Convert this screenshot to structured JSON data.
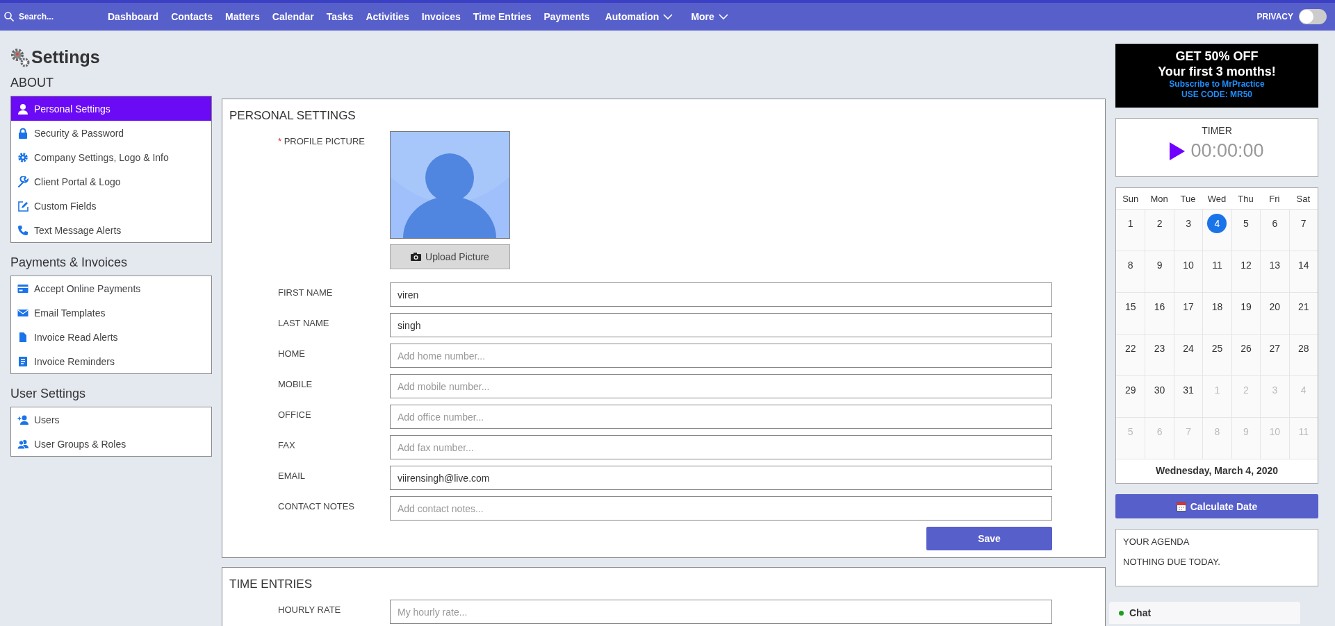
{
  "top_nav": {
    "search": {
      "placeholder": "Search..."
    },
    "items": [
      {
        "label": "Dashboard",
        "dropdown": false
      },
      {
        "label": "Contacts",
        "dropdown": false
      },
      {
        "label": "Matters",
        "dropdown": false
      },
      {
        "label": "Calendar",
        "dropdown": false
      },
      {
        "label": "Tasks",
        "dropdown": false
      },
      {
        "label": "Activities",
        "dropdown": false
      },
      {
        "label": "Invoices",
        "dropdown": false
      },
      {
        "label": "Time Entries",
        "dropdown": false
      },
      {
        "label": "Payments",
        "dropdown": false
      },
      {
        "label": "Automation",
        "dropdown": true
      },
      {
        "label": "More",
        "dropdown": true
      }
    ],
    "privacy": {
      "label": "PRIVACY",
      "on": false
    }
  },
  "page_title": "Settings",
  "sidebar": {
    "sections": [
      {
        "title": "ABOUT",
        "items": [
          {
            "label": "Personal Settings",
            "selected": true
          },
          {
            "label": "Security & Password",
            "selected": false
          },
          {
            "label": "Company Settings, Logo & Info",
            "selected": false
          },
          {
            "label": "Client Portal & Logo",
            "selected": false
          },
          {
            "label": "Custom Fields",
            "selected": false
          },
          {
            "label": "Text Message Alerts",
            "selected": false
          }
        ]
      },
      {
        "title": "Payments & Invoices",
        "items": [
          {
            "label": "Accept Online Payments",
            "selected": false
          },
          {
            "label": "Email Templates",
            "selected": false
          },
          {
            "label": "Invoice Read Alerts",
            "selected": false
          },
          {
            "label": "Invoice Reminders",
            "selected": false
          }
        ]
      },
      {
        "title": "User Settings",
        "items": [
          {
            "label": "Users",
            "selected": false
          },
          {
            "label": "User Groups & Roles",
            "selected": false
          }
        ]
      }
    ]
  },
  "personal_settings": {
    "title": "PERSONAL SETTINGS",
    "profile_picture": {
      "label": "PROFILE PICTURE",
      "required_mark": "*",
      "upload_button": "Upload Picture"
    },
    "fields": [
      {
        "label": "FIRST NAME",
        "value": "viren"
      },
      {
        "label": "LAST NAME",
        "value": "singh"
      },
      {
        "label": "HOME",
        "placeholder": "Add home number..."
      },
      {
        "label": "MOBILE",
        "placeholder": "Add mobile number..."
      },
      {
        "label": "OFFICE",
        "placeholder": "Add office number..."
      },
      {
        "label": "FAX",
        "placeholder": "Add fax number..."
      },
      {
        "label": "EMAIL",
        "value": "viirensingh@live.com"
      },
      {
        "label": "CONTACT NOTES",
        "placeholder": "Add contact notes..."
      }
    ],
    "save_button": "Save"
  },
  "time_entries": {
    "title": "TIME ENTRIES",
    "fields": [
      {
        "label": "HOURLY RATE",
        "placeholder": "My hourly rate..."
      }
    ]
  },
  "promo": {
    "headline": "GET 50% OFF",
    "subheadline": "Your first 3 months!",
    "link": "Subscribe to MrPractice",
    "code": "USE CODE: MR50"
  },
  "timer": {
    "title": "TIMER",
    "time": "00:00:00"
  },
  "calendar": {
    "weekdays": [
      "Sun",
      "Mon",
      "Tue",
      "Wed",
      "Thu",
      "Fri",
      "Sat"
    ],
    "weeks": [
      [
        {
          "day": "1",
          "other_month": false,
          "selected": false
        },
        {
          "day": "2",
          "other_month": false,
          "selected": false
        },
        {
          "day": "3",
          "other_month": false,
          "selected": false
        },
        {
          "day": "4",
          "other_month": false,
          "selected": true
        },
        {
          "day": "5",
          "other_month": false,
          "selected": false
        },
        {
          "day": "6",
          "other_month": false,
          "selected": false
        },
        {
          "day": "7",
          "other_month": false,
          "selected": false
        }
      ],
      [
        {
          "day": "8",
          "other_month": false,
          "selected": false
        },
        {
          "day": "9",
          "other_month": false,
          "selected": false
        },
        {
          "day": "10",
          "other_month": false,
          "selected": false
        },
        {
          "day": "11",
          "other_month": false,
          "selected": false
        },
        {
          "day": "12",
          "other_month": false,
          "selected": false
        },
        {
          "day": "13",
          "other_month": false,
          "selected": false
        },
        {
          "day": "14",
          "other_month": false,
          "selected": false
        }
      ],
      [
        {
          "day": "15",
          "other_month": false,
          "selected": false
        },
        {
          "day": "16",
          "other_month": false,
          "selected": false
        },
        {
          "day": "17",
          "other_month": false,
          "selected": false
        },
        {
          "day": "18",
          "other_month": false,
          "selected": false
        },
        {
          "day": "19",
          "other_month": false,
          "selected": false
        },
        {
          "day": "20",
          "other_month": false,
          "selected": false
        },
        {
          "day": "21",
          "other_month": false,
          "selected": false
        }
      ],
      [
        {
          "day": "22",
          "other_month": false,
          "selected": false
        },
        {
          "day": "23",
          "other_month": false,
          "selected": false
        },
        {
          "day": "24",
          "other_month": false,
          "selected": false
        },
        {
          "day": "25",
          "other_month": false,
          "selected": false
        },
        {
          "day": "26",
          "other_month": false,
          "selected": false
        },
        {
          "day": "27",
          "other_month": false,
          "selected": false
        },
        {
          "day": "28",
          "other_month": false,
          "selected": false
        }
      ],
      [
        {
          "day": "29",
          "other_month": false,
          "selected": false
        },
        {
          "day": "30",
          "other_month": false,
          "selected": false
        },
        {
          "day": "31",
          "other_month": false,
          "selected": false
        },
        {
          "day": "1",
          "other_month": true,
          "selected": false
        },
        {
          "day": "2",
          "other_month": true,
          "selected": false
        },
        {
          "day": "3",
          "other_month": true,
          "selected": false
        },
        {
          "day": "4",
          "other_month": true,
          "selected": false
        }
      ],
      [
        {
          "day": "5",
          "other_month": true,
          "selected": false
        },
        {
          "day": "6",
          "other_month": true,
          "selected": false
        },
        {
          "day": "7",
          "other_month": true,
          "selected": false
        },
        {
          "day": "8",
          "other_month": true,
          "selected": false
        },
        {
          "day": "9",
          "other_month": true,
          "selected": false
        },
        {
          "day": "10",
          "other_month": true,
          "selected": false
        },
        {
          "day": "11",
          "other_month": true,
          "selected": false
        }
      ]
    ],
    "selected_date": "Wednesday, March 4, 2020"
  },
  "calculate_button": "Calculate Date",
  "agenda": {
    "title": "YOUR AGENDA",
    "message": "NOTHING DUE TODAY."
  },
  "chat": {
    "label": "Chat"
  }
}
